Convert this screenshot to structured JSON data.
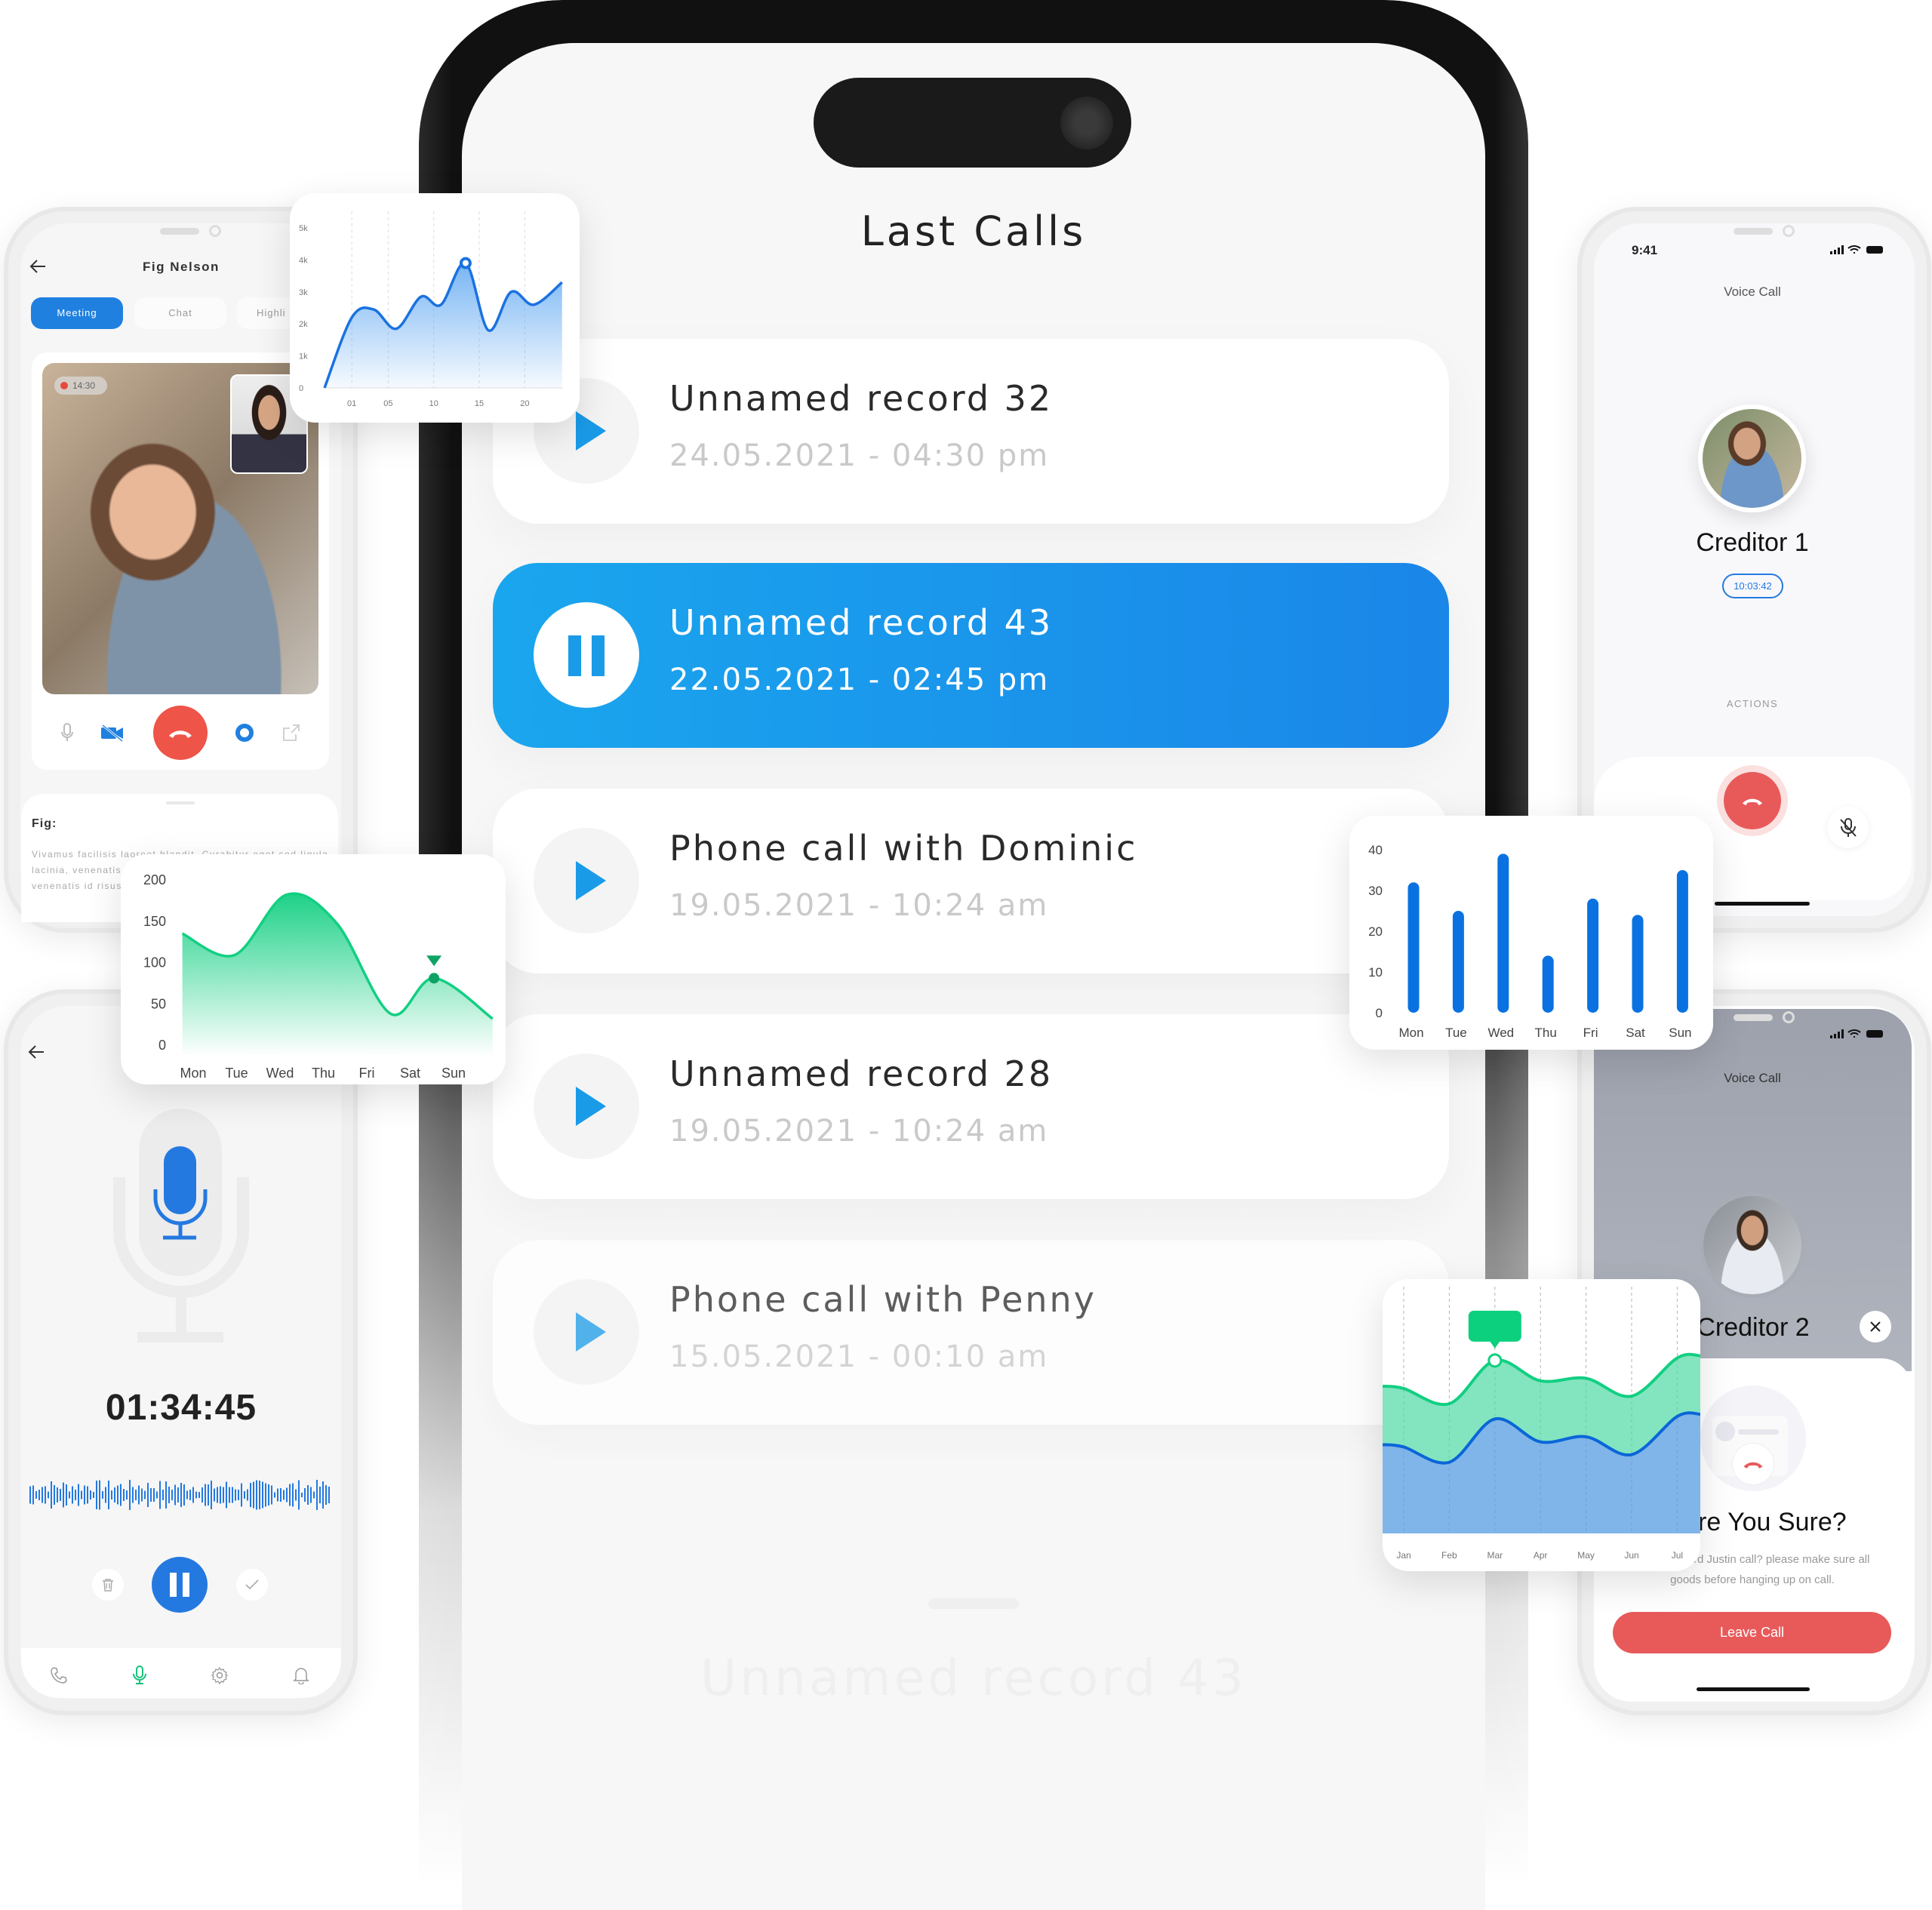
{
  "main": {
    "title": "Last Calls",
    "calls": [
      {
        "title": "Unnamed record 32",
        "date": "24.05.2021 - 04:30 pm",
        "state": "play"
      },
      {
        "title": "Unnamed record 43",
        "date": "22.05.2021 - 02:45 pm",
        "state": "pause"
      },
      {
        "title": "Phone call with Dominic",
        "date": "19.05.2021 - 10:24 am",
        "state": "play"
      },
      {
        "title": "Unnamed record 28",
        "date": "19.05.2021 - 10:24 am",
        "state": "play"
      },
      {
        "title": "Phone call with Penny",
        "date": "15.05.2021 - 00:10 am",
        "state": "play"
      }
    ],
    "now_playing": "Unnamed record 43"
  },
  "meeting_phone": {
    "title": "Fig Nelson",
    "tabs": [
      "Meeting",
      "Chat",
      "Highli"
    ],
    "active_tab": "Meeting",
    "timer": "14:30",
    "notes_title": "Fig:",
    "notes_lines": [
      "Vivamus facilisis laoreet blandit. Curabitur eget sed ligula",
      "lacinia, venenatis",
      "venenatis id risus"
    ]
  },
  "recorder_phone": {
    "elapsed": "01:34:45",
    "nav": [
      "phone-icon",
      "mic-icon",
      "gear-icon",
      "bell-icon"
    ],
    "active_nav": "mic-icon"
  },
  "voice_call_1": {
    "time": "9:41",
    "header": "Voice Call",
    "name": "Creditor 1",
    "duration": "10:03:42",
    "actions_label": "ACTIONS"
  },
  "voice_call_2": {
    "header": "Voice Call",
    "name": "Creditor 2",
    "confirm_title": "Are You Sure?",
    "confirm_line1": "rd Justin call? please make sure all",
    "confirm_line2": "goods before hanging up on call.",
    "leave_button": "Leave Call"
  },
  "colors": {
    "blue": "#1a86e8",
    "accent_blue": "#0a72e0",
    "green": "#12cf82",
    "red": "#e85a5a"
  },
  "chart_data": [
    {
      "type": "area",
      "ylim": [
        0,
        5000
      ],
      "yticks": [
        "0",
        "1k",
        "2k",
        "3k",
        "4k",
        "5k"
      ],
      "ytick_values": [
        0,
        1000,
        2000,
        3000,
        4000,
        5000
      ],
      "xlim": [
        -2,
        24.2
      ],
      "xticks": [
        "01",
        "05",
        "10",
        "15",
        "20"
      ],
      "xtick_values": [
        1,
        5,
        10,
        15,
        20
      ],
      "x": [
        -2,
        1,
        3.4,
        5.9,
        8.6,
        10.8,
        13.5,
        16,
        18.5,
        21,
        24.1
      ],
      "values": [
        0,
        2200,
        2450,
        1850,
        2850,
        2600,
        3900,
        1800,
        3000,
        2600,
        3300
      ],
      "highlight_index": 6,
      "grid": "vertical dashed"
    },
    {
      "type": "area",
      "categories": [
        "Mon",
        "Tue",
        "Wed",
        "Thu",
        "Fri",
        "Sat",
        "Sun"
      ],
      "ylim": [
        0,
        200
      ],
      "yticks": [
        "0",
        "50",
        "100",
        "150",
        "200"
      ],
      "ytick_values": [
        0,
        50,
        100,
        150,
        200
      ],
      "x": [
        -0.25,
        0.95,
        2.15,
        3.3,
        4.55,
        5.55,
        6.9
      ],
      "values": [
        135,
        109,
        182,
        148,
        38,
        81,
        32
      ],
      "highlight_index": 5,
      "grid": "off"
    },
    {
      "type": "bar",
      "categories": [
        "Mon",
        "Tue",
        "Wed",
        "Thu",
        "Fri",
        "Sat",
        "Sun"
      ],
      "values": [
        32,
        25,
        39,
        14,
        28,
        24,
        35
      ],
      "ylim": [
        0,
        40
      ],
      "yticks": [
        "0",
        "10",
        "20",
        "30",
        "40"
      ],
      "ytick_values": [
        0,
        10,
        20,
        30,
        40
      ],
      "grid": "off"
    },
    {
      "type": "area",
      "categories": [
        "Jan",
        "Feb",
        "Mar",
        "Apr",
        "May",
        "Jun",
        "Jul"
      ],
      "xlim": [
        -0.45,
        6.5
      ],
      "ylim": [
        0,
        100
      ],
      "series": [
        {
          "values": [
            57,
            51,
            68,
            60,
            61,
            54,
            69
          ],
          "color": "#12cf82"
        },
        {
          "values": [
            34,
            28,
            45,
            36,
            38,
            31,
            46
          ],
          "color": "#0a66d8"
        }
      ],
      "highlight": {
        "series": 0,
        "index": 2
      },
      "grid": "vertical dashed"
    }
  ]
}
